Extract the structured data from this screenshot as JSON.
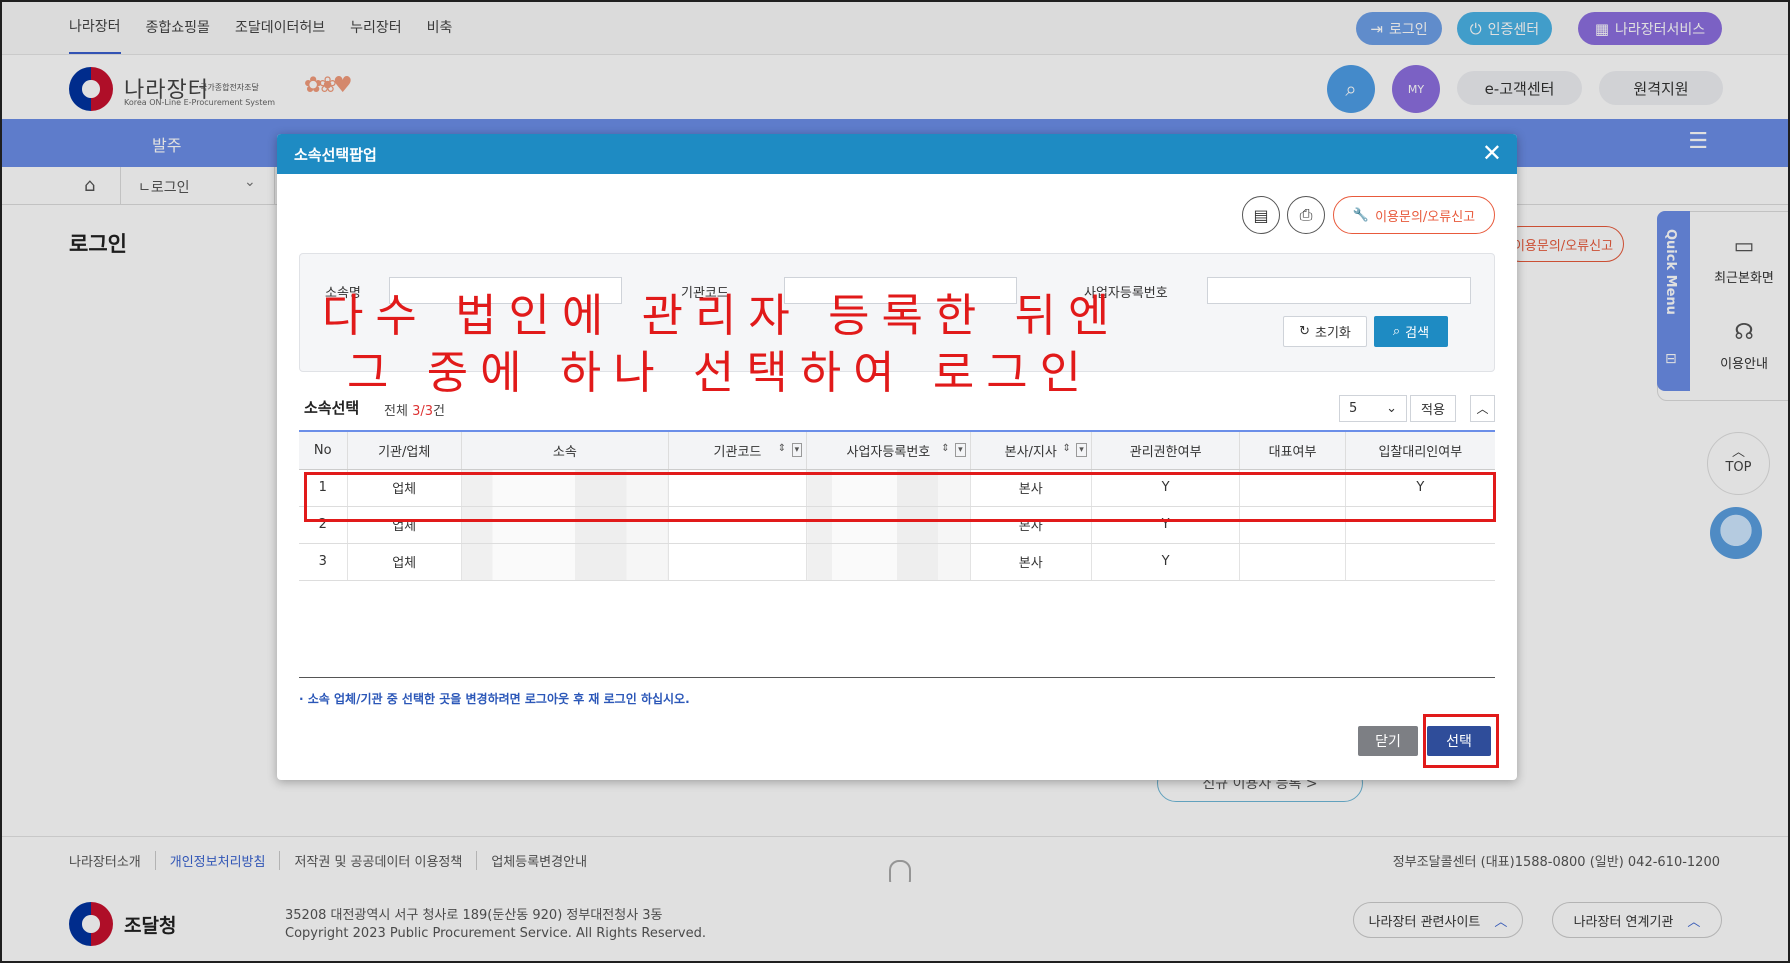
{
  "topnav": [
    "나라장터",
    "종합쇼핑몰",
    "조달데이터허브",
    "누리장터",
    "비축"
  ],
  "top_buttons": {
    "login": "로그인",
    "cert": "인증센터",
    "service": "나라장터서비스"
  },
  "header": {
    "logo": "나라장터",
    "logo_sub": "국가종합전자조달",
    "logo_en": "Korea ON-Line E-Procurement System",
    "help": "e-고객센터",
    "remote": "원격지원",
    "my": "MY"
  },
  "menubar": {
    "label": "발주"
  },
  "breadcrumb": {
    "current": "ㄴ로그인"
  },
  "page": {
    "title": "로그인",
    "report": "이용문의/오류신고",
    "outline": "신규 이용자 등록 >"
  },
  "quick": {
    "title": "Quick Menu",
    "recent": "최근본화면",
    "guide": "이용안내",
    "top": "TOP"
  },
  "modal": {
    "title": "소속선택팝업",
    "report_label": "이용문의/오류신고",
    "search": {
      "name_label": "소속명",
      "code_label": "기관코드",
      "biz_label": "사업자등록번호",
      "reset": "초기화",
      "search": "검색"
    },
    "list_title": "소속선택",
    "count_prefix": "전체 ",
    "count": "3/3",
    "count_suffix": "건",
    "page_size": "5",
    "apply": "적용",
    "columns": [
      "No",
      "기관/업체",
      "소속",
      "기관코드",
      "사업자등록번호",
      "본사/지사",
      "관리권한여부",
      "대표여부",
      "입찰대리인여부"
    ],
    "rows": [
      [
        "1",
        "업체",
        "",
        "",
        "",
        "본사",
        "Y",
        "",
        "Y"
      ],
      [
        "2",
        "업체",
        "",
        "",
        "",
        "본사",
        "Y",
        "",
        ""
      ],
      [
        "3",
        "업체",
        "",
        "",
        "",
        "본사",
        "Y",
        "",
        ""
      ]
    ],
    "note": "· 소속 업체/기관 중 선택한 곳을 변경하려면 로그아웃 후 재 로그인 하십시오.",
    "close": "닫기",
    "select": "선택"
  },
  "annotation": {
    "line1": "다수 법인에 관리자 등록한 뒤엔",
    "line2": "그 중에 하나 선택하여 로그인"
  },
  "footer": {
    "links": [
      "나라장터소개",
      "개인정보처리방침",
      "저작권 및 공공데이터 이용정책",
      "업체등록변경안내"
    ],
    "phone": "정부조달콜센터 (대표)1588-0800 (일반) 042-610-1200",
    "org": "조달청",
    "address": "35208 대전광역시 서구 청사로 189(둔산동 920) 정부대전청사 3동",
    "copyright": "Copyright 2023 Public Procurement Service. All Rights Reserved.",
    "related": "나라장터 관련사이트",
    "linked": "나라장터 연계기관"
  },
  "colors": {
    "accent": "#1e8bc3",
    "menu": "#6b8ee8",
    "highlight": "#e11a1a",
    "select_btn": "#2f4d9a"
  }
}
